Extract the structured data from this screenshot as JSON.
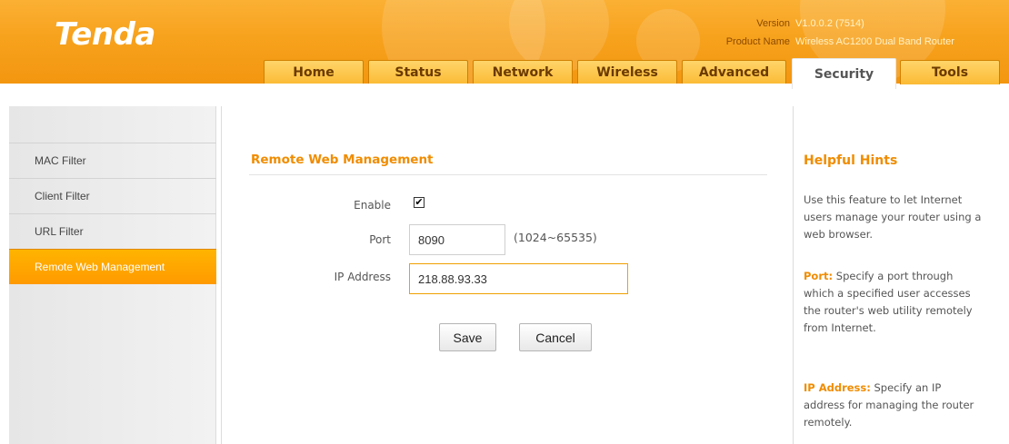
{
  "brand": {
    "logo_text": "Tenda",
    "accent": "#f08c00",
    "header_orange": "#f7a21d"
  },
  "header": {
    "version_label": "Version",
    "version_value": "V1.0.0.2 (7514)",
    "product_label": "Product Name",
    "product_value": "Wireless AC1200 Dual Band Router"
  },
  "tabs": [
    {
      "label": "Home",
      "active": false
    },
    {
      "label": "Status",
      "active": false
    },
    {
      "label": "Network",
      "active": false
    },
    {
      "label": "Wireless",
      "active": false
    },
    {
      "label": "Advanced",
      "active": false
    },
    {
      "label": "Security",
      "active": true
    },
    {
      "label": "Tools",
      "active": false
    }
  ],
  "sidebar": {
    "items": [
      {
        "label": "MAC Filter"
      },
      {
        "label": "Client Filter"
      },
      {
        "label": "URL Filter"
      },
      {
        "label": "Remote Web Management",
        "active": true
      }
    ]
  },
  "form": {
    "title": "Remote Web Management",
    "enable_label": "Enable",
    "enable_checked": true,
    "checkbox_glyph": "✔",
    "port_label": "Port",
    "port_value": "8090",
    "port_hint": "(1024~65535)",
    "ip_label": "IP Address",
    "ip_value": "218.88.93.33",
    "save_label": "Save",
    "cancel_label": "Cancel"
  },
  "hints": {
    "title": "Helpful Hints",
    "intro": "Use this feature to let Internet users manage your router using a web browser.",
    "port_key": "Port:",
    "port_text": " Specify a port through which a specified user accesses the router's web utility remotely from Internet.",
    "ip_key": "IP Address:",
    "ip_text": " Specify an IP address for managing the router remotely."
  }
}
